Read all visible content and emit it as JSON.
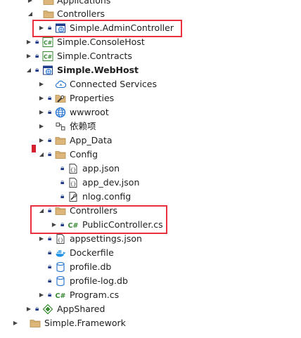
{
  "tree": {
    "rows": [
      {
        "label": "Applications",
        "icon": "folder-icon",
        "expanded": false
      },
      {
        "label": "Controllers",
        "icon": "folder-icon",
        "expanded": true
      },
      {
        "label": "Simple.AdminController",
        "icon": "web-project-icon",
        "expanded": false
      },
      {
        "label": "Simple.ConsoleHost",
        "icon": "csharp-project-icon",
        "expanded": false
      },
      {
        "label": "Simple.Contracts",
        "icon": "csharp-project-icon",
        "expanded": false
      },
      {
        "label": "Simple.WebHost",
        "icon": "web-project-icon",
        "expanded": true
      },
      {
        "label": "Connected Services",
        "icon": "connected-services-icon",
        "expanded": false
      },
      {
        "label": "Properties",
        "icon": "properties-icon",
        "expanded": false
      },
      {
        "label": "wwwroot",
        "icon": "globe-icon",
        "expanded": false
      },
      {
        "label": "依赖项",
        "icon": "dependencies-icon",
        "expanded": false
      },
      {
        "label": "App_Data",
        "icon": "folder-icon",
        "expanded": false
      },
      {
        "label": "Config",
        "icon": "folder-icon",
        "expanded": true
      },
      {
        "label": "app.json",
        "icon": "json-file-icon"
      },
      {
        "label": "app_dev.json",
        "icon": "json-file-icon"
      },
      {
        "label": "nlog.config",
        "icon": "config-file-icon"
      },
      {
        "label": "Controllers",
        "icon": "folder-icon",
        "expanded": true
      },
      {
        "label": "PublicController.cs",
        "icon": "csharp-file-icon",
        "expanded": false
      },
      {
        "label": "appsettings.json",
        "icon": "json-file-icon",
        "expanded": false
      },
      {
        "label": "Dockerfile",
        "icon": "docker-icon"
      },
      {
        "label": "profile.db",
        "icon": "database-icon"
      },
      {
        "label": "profile-log.db",
        "icon": "database-icon"
      },
      {
        "label": "Program.cs",
        "icon": "csharp-file-icon",
        "expanded": false
      },
      {
        "label": "AppShared",
        "icon": "shared-project-icon",
        "expanded": false
      },
      {
        "label": "Simple.Framework",
        "icon": "folder-icon",
        "expanded": false
      }
    ]
  },
  "colors": {
    "highlight_box": "#e8313f",
    "folder": "#dcb67a",
    "csharp": "#388a34",
    "web": "#1e6fd0",
    "lock": "#1e3a8a"
  }
}
